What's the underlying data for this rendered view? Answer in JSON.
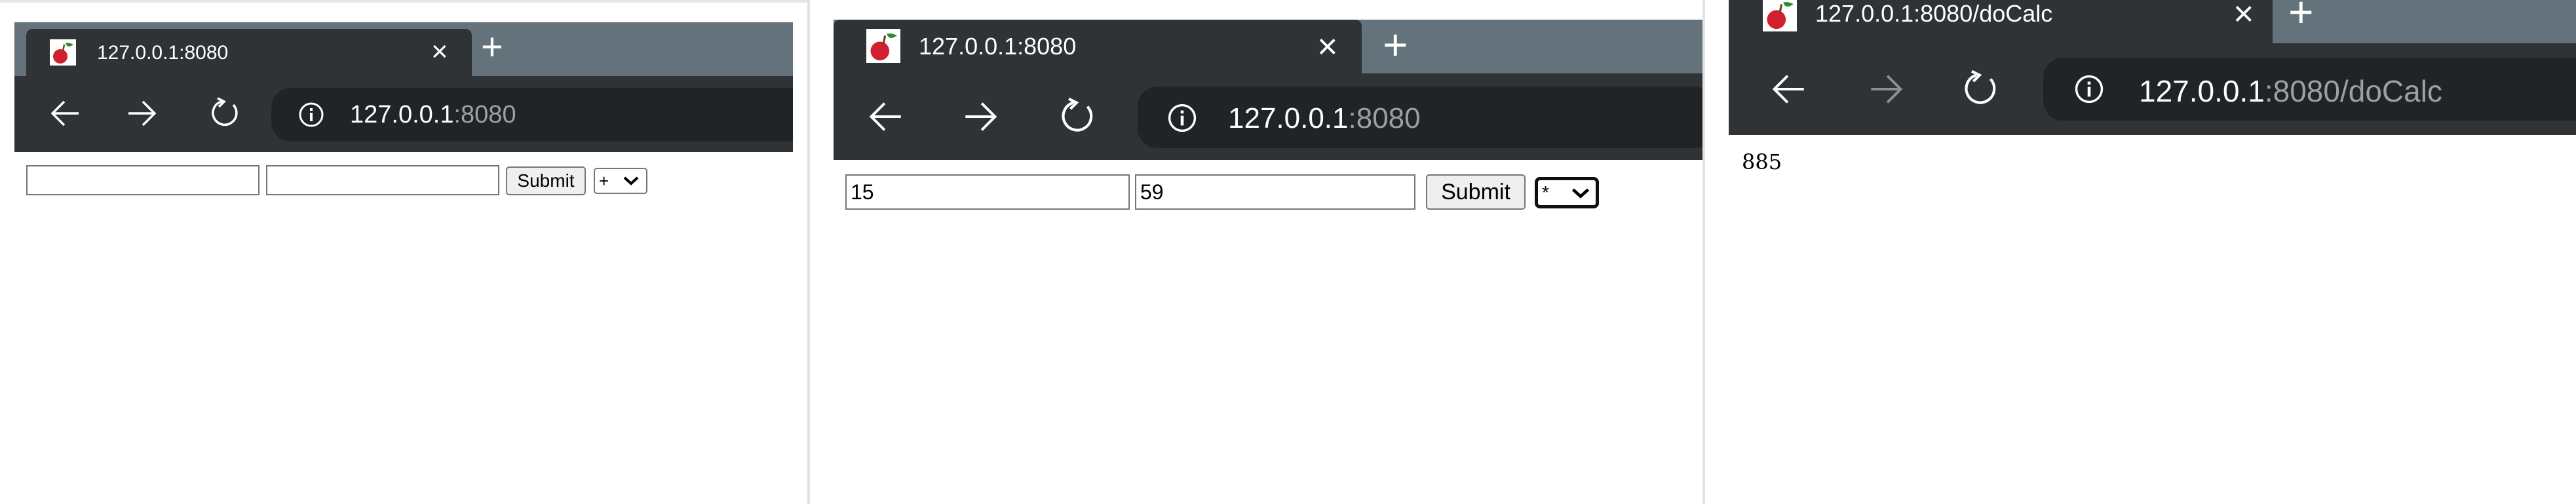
{
  "panels": [
    {
      "tab": {
        "title": "127.0.0.1:8080",
        "close": "×",
        "new_tab": "+"
      },
      "omnibox": {
        "host": "127.0.0.1",
        "rest": ":8080"
      },
      "form": {
        "first_value": "",
        "second_value": "",
        "submit_label": "Submit",
        "operator": "+"
      }
    },
    {
      "tab": {
        "title": "127.0.0.1:8080",
        "close": "×",
        "new_tab": "+"
      },
      "omnibox": {
        "host": "127.0.0.1",
        "rest": ":8080"
      },
      "form": {
        "first_value": "15",
        "second_value": "59",
        "submit_label": "Submit",
        "operator": "*"
      }
    },
    {
      "tab": {
        "title": "127.0.0.1:8080/doCalc",
        "close": "×",
        "new_tab": "+"
      },
      "omnibox": {
        "host": "127.0.0.1",
        "rest": ":8080/doCalc"
      },
      "result": "885"
    }
  ],
  "colors": {
    "tab_strip": "#64727b",
    "toolbar": "#2f3336",
    "omnibox": "#202427",
    "url_dim": "#9aa0a6"
  }
}
